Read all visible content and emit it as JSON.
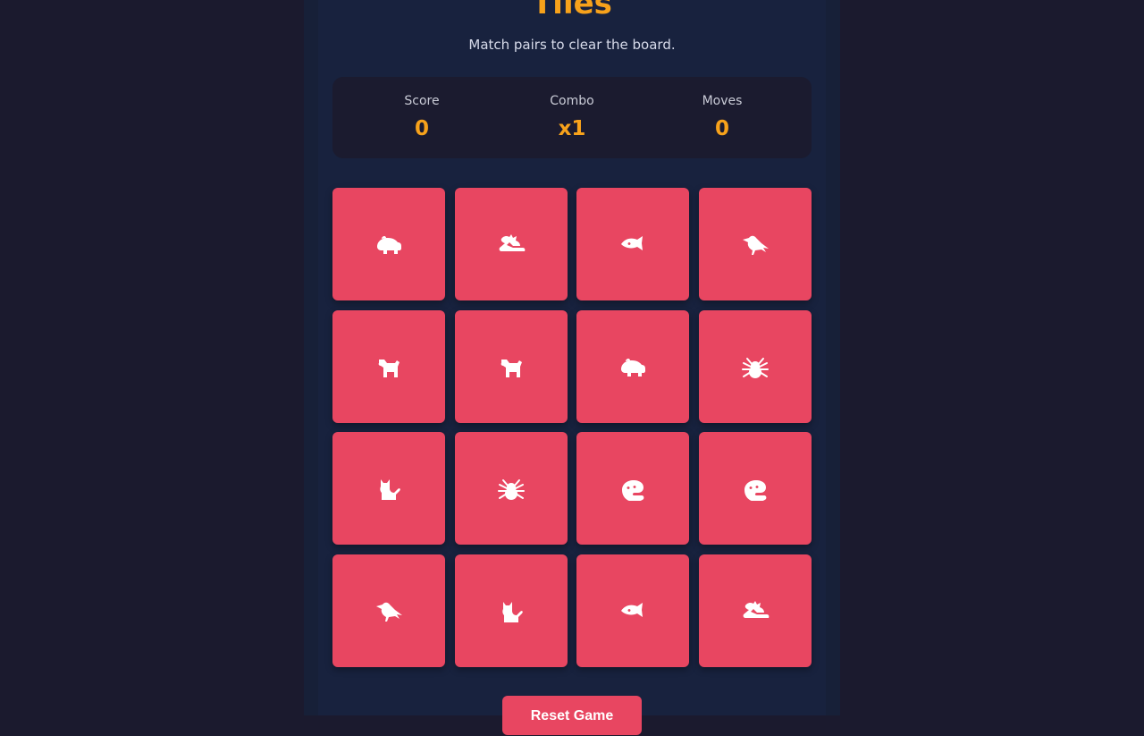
{
  "game": {
    "title": "Tiles",
    "subtitle": "Match pairs to clear the board."
  },
  "stats": [
    {
      "label": "Score",
      "value": "0"
    },
    {
      "label": "Combo",
      "value": "x1"
    },
    {
      "label": "Moves",
      "value": "0"
    }
  ],
  "tiles": [
    "hippo",
    "dragon",
    "fish",
    "crow",
    "dog",
    "dog",
    "hippo",
    "spider",
    "cat",
    "spider",
    "otter",
    "otter",
    "crow",
    "cat",
    "fish",
    "dragon"
  ],
  "colors": {
    "accent": "#f7a21b",
    "tile": "#e84661",
    "background": "#1b1a2e",
    "panel": "#18223e"
  },
  "reset_button": {
    "label": "Reset Game"
  }
}
